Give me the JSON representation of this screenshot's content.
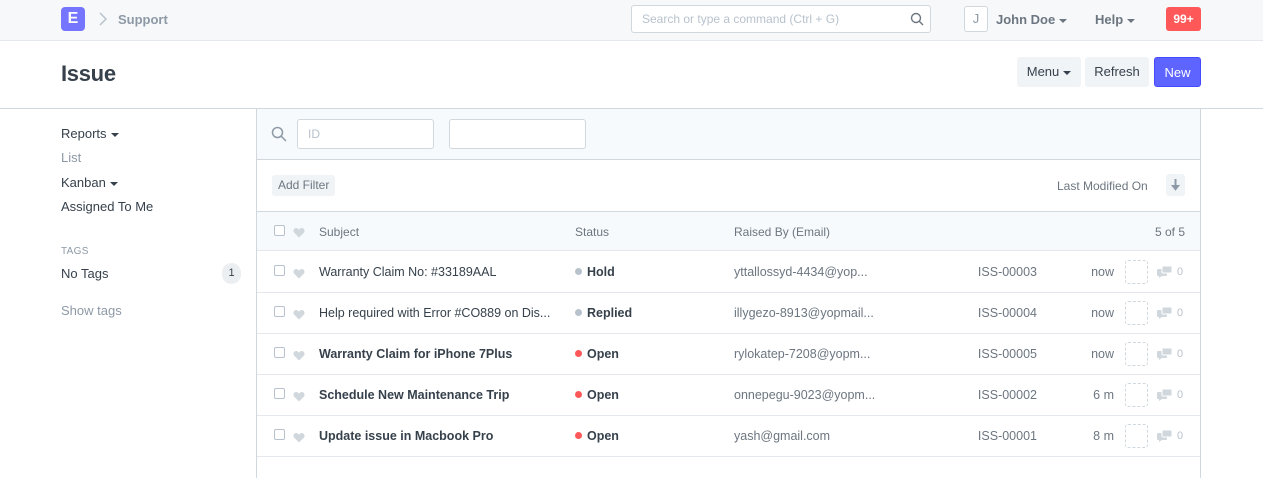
{
  "navbar": {
    "logo_letter": "E",
    "breadcrumb": "Support",
    "search_placeholder": "Search or type a command (Ctrl + G)",
    "avatar_letter": "J",
    "user_name": "John Doe",
    "help_label": "Help",
    "notification_count": "99+"
  },
  "page": {
    "title": "Issue",
    "menu_label": "Menu",
    "refresh_label": "Refresh",
    "new_label": "New"
  },
  "sidebar": {
    "items": [
      {
        "label": "Reports",
        "dropdown": true
      },
      {
        "label": "List",
        "dropdown": false
      },
      {
        "label": "Kanban",
        "dropdown": true
      },
      {
        "label": "Assigned To Me",
        "dropdown": false
      }
    ],
    "tags_heading": "TAGS",
    "no_tags_label": "No Tags",
    "no_tags_count": "1",
    "show_tags_label": "Show tags"
  },
  "filters": {
    "id_placeholder": "ID",
    "second_placeholder": "",
    "add_filter_label": "Add Filter",
    "sort_label": "Last Modified On"
  },
  "list": {
    "columns": {
      "subject": "Subject",
      "status": "Status",
      "raised_by": "Raised By (Email)",
      "count": "5 of 5"
    },
    "rows": [
      {
        "subject": "Warranty Claim No: #33189AAL",
        "bold": false,
        "status": "Hold",
        "status_color": "#b8c2cc",
        "email": "yttallossyd-4434@yop...",
        "id": "ISS-00003",
        "modified": "now",
        "comments": "0"
      },
      {
        "subject": "Help required with Error #CO889 on Dis...",
        "bold": false,
        "status": "Replied",
        "status_color": "#b8c2cc",
        "email": "illygezo-8913@yopmail...",
        "id": "ISS-00004",
        "modified": "now",
        "comments": "0"
      },
      {
        "subject": "Warranty Claim for iPhone 7Plus",
        "bold": true,
        "status": "Open",
        "status_color": "#ff5858",
        "email": "rylokatep-7208@yopm...",
        "id": "ISS-00005",
        "modified": "now",
        "comments": "0"
      },
      {
        "subject": "Schedule New Maintenance Trip",
        "bold": true,
        "status": "Open",
        "status_color": "#ff5858",
        "email": "onnepegu-9023@yopm...",
        "id": "ISS-00002",
        "modified": "6 m",
        "comments": "0"
      },
      {
        "subject": "Update issue in Macbook Pro",
        "bold": true,
        "status": "Open",
        "status_color": "#ff5858",
        "email": "yash@gmail.com",
        "id": "ISS-00001",
        "modified": "8 m",
        "comments": "0"
      }
    ]
  },
  "colors": {
    "brand": "#7575ff",
    "primary_button": "#5e64ff",
    "notification": "#ff5858",
    "status_open": "#ff5858",
    "status_neutral": "#b8c2cc"
  },
  "icons": {
    "breadcrumb_separator": "chevron-right-icon",
    "search": "search-icon",
    "dropdown": "caret-down-icon",
    "like": "heart-icon",
    "sort": "sort-descending-icon",
    "comment": "comment-icon"
  }
}
